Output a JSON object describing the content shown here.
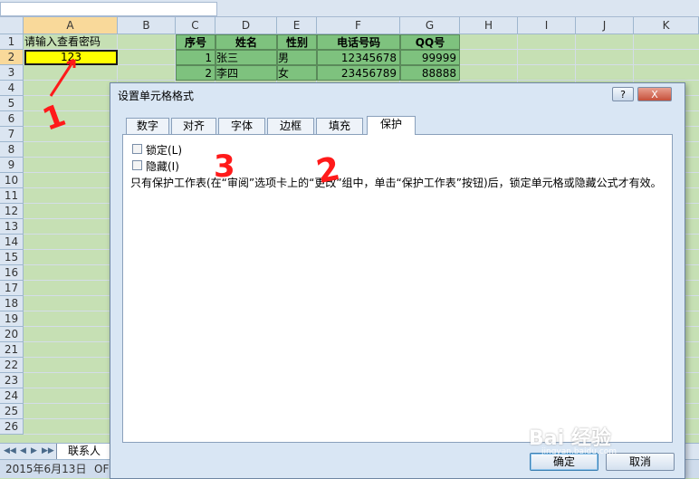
{
  "columns": [
    "A",
    "B",
    "C",
    "D",
    "E",
    "F",
    "G",
    "H",
    "I",
    "J",
    "K"
  ],
  "rows": [
    "1",
    "2",
    "3",
    "4",
    "5",
    "6",
    "7",
    "8",
    "9",
    "10",
    "11",
    "12",
    "13",
    "14",
    "15",
    "16",
    "17",
    "18",
    "19",
    "20",
    "21",
    "22",
    "23",
    "24",
    "25",
    "26"
  ],
  "cells": {
    "a1": "请输入查看密码",
    "a2": "123"
  },
  "table": {
    "headers": [
      "序号",
      "姓名",
      "性别",
      "电话号码",
      "QQ号"
    ],
    "rows": [
      [
        "1",
        "张三",
        "男",
        "12345678",
        "99999"
      ],
      [
        "2",
        "李四",
        "女",
        "23456789",
        "88888"
      ]
    ]
  },
  "sheet_tab": "联系人",
  "status": {
    "date": "2015年6月13日",
    "mode": "OF"
  },
  "dialog": {
    "title": "设置单元格格式",
    "help": "?",
    "close": "X",
    "tabs": [
      "数字",
      "对齐",
      "字体",
      "边框",
      "填充",
      "保护"
    ],
    "active_tab": "保护",
    "lock_label": "锁定(L)",
    "hide_label": "隐藏(I)",
    "description": "只有保护工作表(在“审阅”选项卡上的“更改”组中，单击“保护工作表”按钮)后，锁定单元格或隐藏公式才有效。",
    "ok": "确定",
    "cancel": "取消"
  },
  "annotations": [
    "1",
    "2",
    "3"
  ],
  "watermark": "Bai 经验",
  "watermark_url": "jingyan.baidu.com",
  "colors": {
    "header_green": "#7ec27e",
    "selected_cell": "#ffff00",
    "annotation_red": "#ff1a1a"
  }
}
